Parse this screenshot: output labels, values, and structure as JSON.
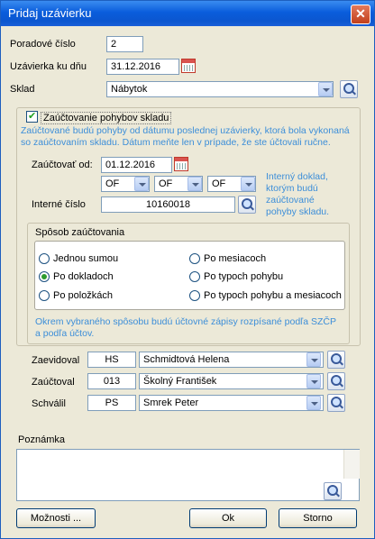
{
  "window": {
    "title": "Pridaj uzávierku",
    "close_glyph": "✕"
  },
  "form": {
    "poradove_cislo_label": "Poradové číslo",
    "poradove_cislo_value": "2",
    "uzavierka_label": "Uzávierka ku dňu",
    "uzavierka_value": "31.12.2016",
    "sklad_label": "Sklad",
    "sklad_value": "Nábytok"
  },
  "zauctovanie": {
    "checkbox_label": "Zaúčtovanie pohybov skladu",
    "checked": true,
    "info_text": "Zaúčtované budú pohyby od dátumu poslednej uzávierky, ktorá bola vykonaná so zaúčtovaním skladu. Dátum meňte len v prípade, že ste účtovali ručne.",
    "zauctovat_od_label": "Zaúčtovať od:",
    "zauctovat_od_value": "01.12.2016",
    "of_values": [
      "OF",
      "OF",
      "OF"
    ],
    "interny_doklad_note": "Interný doklad, ktorým budú zaúčtované pohyby skladu.",
    "interne_cislo_label": "Interné číslo",
    "interne_cislo_value": "10160018"
  },
  "sposob": {
    "title": "Spôsob zaúčtovania",
    "options": [
      {
        "label": "Jednou sumou",
        "selected": false
      },
      {
        "label": "Po mesiacoch",
        "selected": false
      },
      {
        "label": "Po dokladoch",
        "selected": true
      },
      {
        "label": "Po typoch pohybu",
        "selected": false
      },
      {
        "label": "Po položkách",
        "selected": false
      },
      {
        "label": "Po typoch pohybu a mesiacoch",
        "selected": false
      }
    ],
    "note": "Okrem vybraného spôsobu budú účtovné zápisy rozpísané podľa SZČP a podľa účtov."
  },
  "people": [
    {
      "label": "Zaevidoval",
      "code": "HS",
      "name": "Schmidtová Helena"
    },
    {
      "label": "Zaúčtoval",
      "code": "013",
      "name": "Školný František"
    },
    {
      "label": "Schválil",
      "code": "PS",
      "name": "Smrek Peter"
    }
  ],
  "poznamka": {
    "label": "Poznámka",
    "value": ""
  },
  "buttons": {
    "moznosti": "Možnosti ...",
    "ok": "Ok",
    "storno": "Storno"
  }
}
